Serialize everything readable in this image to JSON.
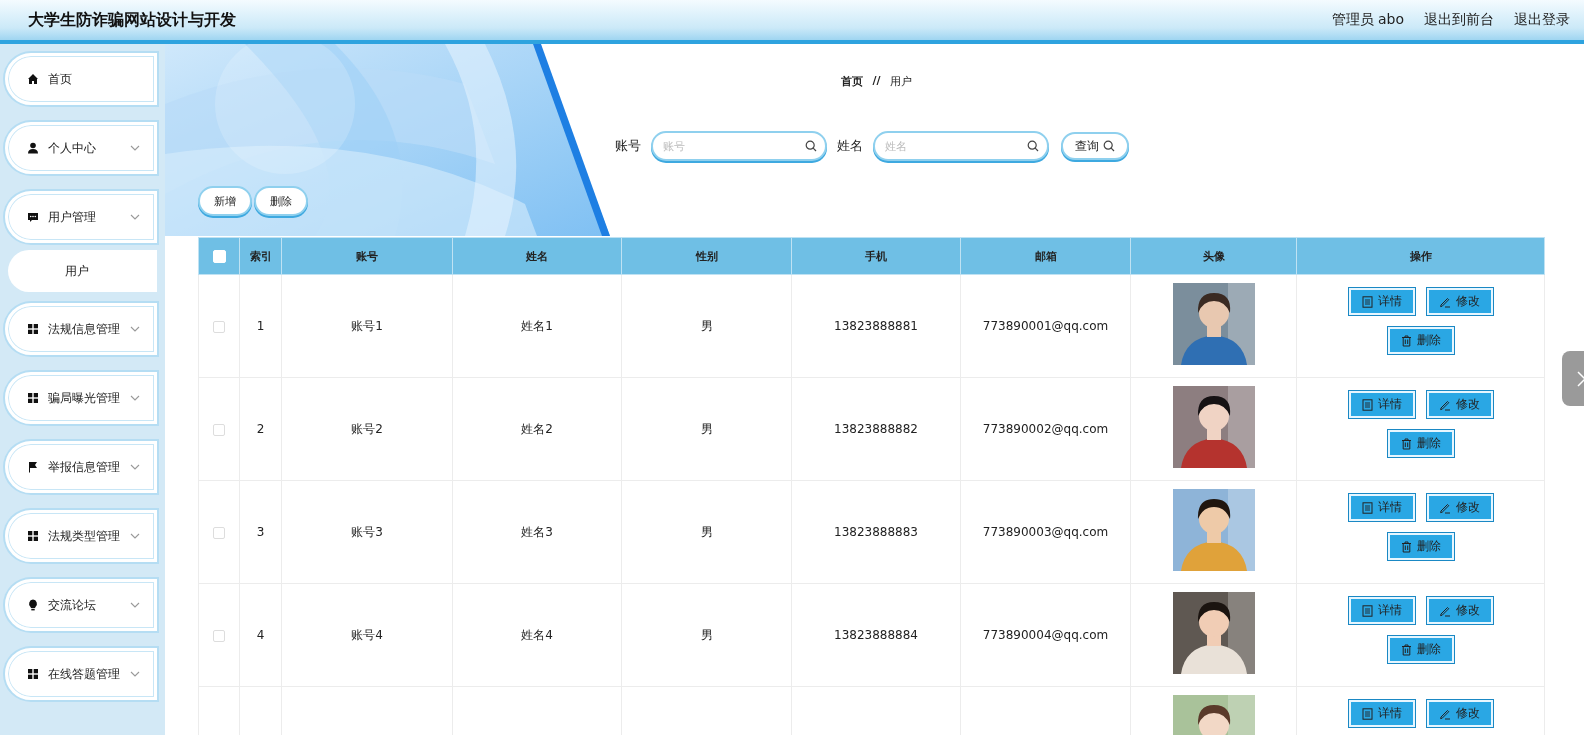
{
  "header": {
    "title": "大学生防诈骗网站设计与开发",
    "links": [
      "管理员 abo",
      "退出到前台",
      "退出登录"
    ]
  },
  "sidebar": {
    "items": [
      {
        "label": "首页",
        "kind": "link"
      },
      {
        "label": "个人中心",
        "kind": "submenu"
      },
      {
        "label": "用户管理",
        "kind": "submenu",
        "children": [
          {
            "label": "用户"
          }
        ]
      },
      {
        "label": "法规信息管理",
        "kind": "submenu"
      },
      {
        "label": "骗局曝光管理",
        "kind": "submenu"
      },
      {
        "label": "举报信息管理",
        "kind": "submenu"
      },
      {
        "label": "法规类型管理",
        "kind": "submenu"
      },
      {
        "label": "交流论坛",
        "kind": "submenu"
      },
      {
        "label": "在线答题管理",
        "kind": "submenu"
      }
    ]
  },
  "breadcrumb": {
    "items": [
      "首页",
      "用户"
    ],
    "separator": "//"
  },
  "search": {
    "fields": [
      {
        "label": "账号",
        "placeholder": "账号"
      },
      {
        "label": "姓名",
        "placeholder": "姓名"
      }
    ],
    "button": "查询"
  },
  "toolbar": [
    "新增",
    "删除"
  ],
  "table": {
    "select_all": {
      "checked": false
    },
    "columns": [
      "索引",
      "账号",
      "姓名",
      "性别",
      "手机",
      "邮箱",
      "头像",
      "操作"
    ],
    "rows": [
      {
        "checked": false,
        "index": "1",
        "account": "账号1",
        "name": "姓名1",
        "gender": "男",
        "phone": "13823888881",
        "email": "773890001@qq.com",
        "avatar": {
          "kind": "picture"
        },
        "actions": [
          {
            "label": "详情",
            "kind": "detail"
          },
          {
            "label": "修改",
            "kind": "edit"
          },
          {
            "label": "删除",
            "kind": "delete"
          }
        ]
      },
      {
        "checked": false,
        "index": "2",
        "account": "账号2",
        "name": "姓名2",
        "gender": "男",
        "phone": "13823888882",
        "email": "773890002@qq.com",
        "avatar": {
          "kind": "picture"
        },
        "actions": [
          {
            "label": "详情",
            "kind": "detail"
          },
          {
            "label": "修改",
            "kind": "edit"
          },
          {
            "label": "删除",
            "kind": "delete"
          }
        ]
      },
      {
        "checked": false,
        "index": "3",
        "account": "账号3",
        "name": "姓名3",
        "gender": "男",
        "phone": "13823888883",
        "email": "773890003@qq.com",
        "avatar": {
          "kind": "picture"
        },
        "actions": [
          {
            "label": "详情",
            "kind": "detail"
          },
          {
            "label": "修改",
            "kind": "edit"
          },
          {
            "label": "删除",
            "kind": "delete"
          }
        ]
      },
      {
        "checked": false,
        "index": "4",
        "account": "账号4",
        "name": "姓名4",
        "gender": "男",
        "phone": "13823888884",
        "email": "773890004@qq.com",
        "avatar": {
          "kind": "picture"
        },
        "actions": [
          {
            "label": "详情",
            "kind": "detail"
          },
          {
            "label": "修改",
            "kind": "edit"
          },
          {
            "label": "删除",
            "kind": "delete"
          }
        ]
      },
      {
        "avatar": {
          "kind": "picture"
        },
        "actions": [
          {
            "label": "详情",
            "kind": "detail"
          },
          {
            "label": "修改",
            "kind": "edit"
          }
        ]
      }
    ]
  }
}
